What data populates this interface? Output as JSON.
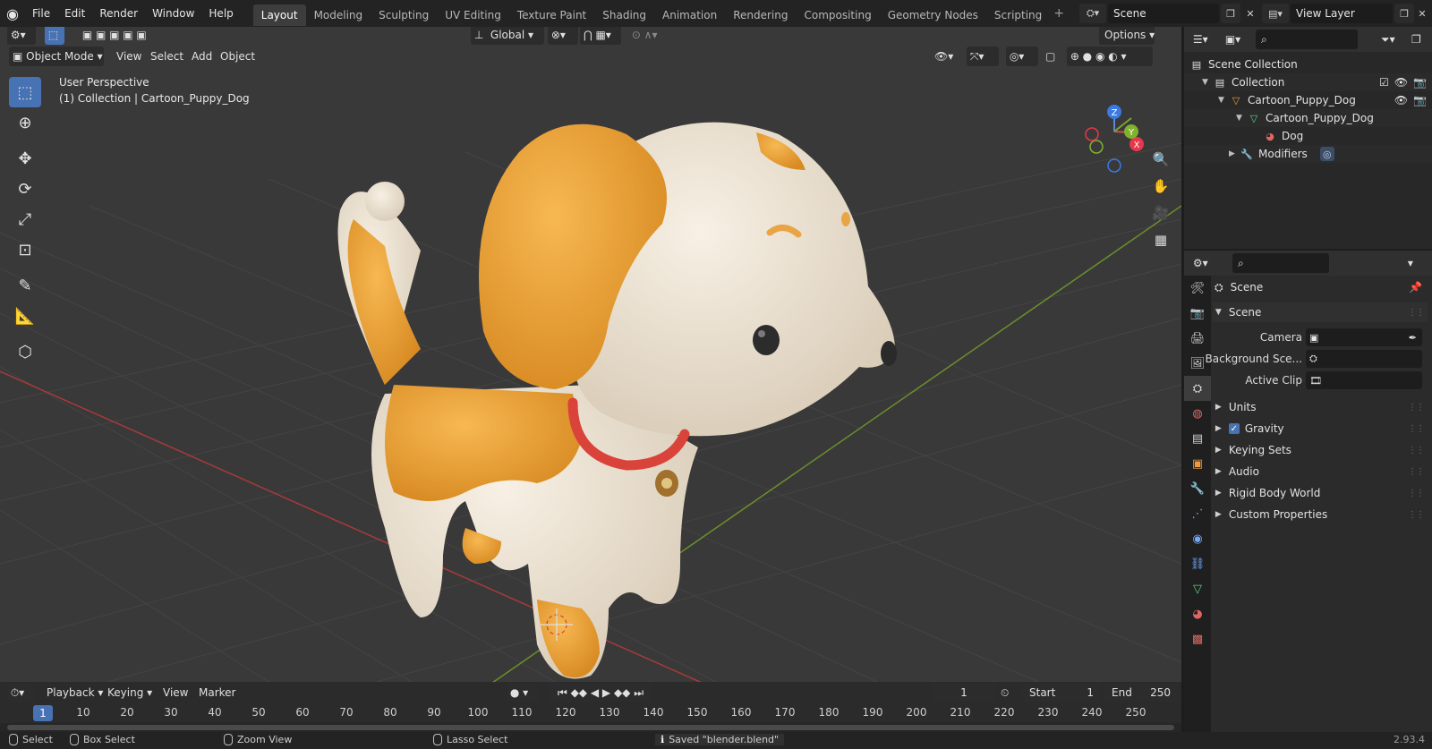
{
  "menubar": {
    "items": [
      "File",
      "Edit",
      "Render",
      "Window",
      "Help"
    ],
    "workspaces": [
      "Layout",
      "Modeling",
      "Sculpting",
      "UV Editing",
      "Texture Paint",
      "Shading",
      "Animation",
      "Rendering",
      "Compositing",
      "Geometry Nodes",
      "Scripting"
    ],
    "active_workspace": "Layout",
    "scene_name": "Scene",
    "view_layer": "View Layer"
  },
  "viewport": {
    "mode": "Object Mode",
    "menu": [
      "View",
      "Select",
      "Add",
      "Object"
    ],
    "transform_orientation": "Global",
    "options_label": "Options",
    "perspective_label": "User Perspective",
    "collection_label": "(1) Collection | Cartoon_Puppy_Dog",
    "gizmo_axes": {
      "x": "X",
      "y": "Y",
      "z": "Z"
    }
  },
  "tools": [
    "select-box-tool",
    "cursor-tool",
    "move-tool",
    "rotate-tool",
    "scale-tool",
    "transform-tool",
    "annotate-tool",
    "measure-tool",
    "add-cube-tool"
  ],
  "timeline": {
    "menu": [
      "Playback",
      "Keying",
      "View",
      "Marker"
    ],
    "current_frame": "1",
    "start_label": "Start",
    "start": "1",
    "end_label": "End",
    "end": "250",
    "ruler": [
      "1",
      "10",
      "20",
      "30",
      "40",
      "50",
      "60",
      "70",
      "80",
      "90",
      "100",
      "110",
      "120",
      "130",
      "140",
      "150",
      "160",
      "170",
      "180",
      "190",
      "200",
      "210",
      "220",
      "230",
      "240",
      "250"
    ]
  },
  "statusbar": {
    "select": "Select",
    "box_select": "Box Select",
    "zoom_view": "Zoom View",
    "lasso_select": "Lasso Select",
    "message": "Saved \"blender.blend\"",
    "version": "2.93.4"
  },
  "outliner": {
    "rows": [
      {
        "label": "Scene Collection"
      },
      {
        "label": "Collection"
      },
      {
        "label": "Cartoon_Puppy_Dog"
      },
      {
        "label": "Cartoon_Puppy_Dog"
      },
      {
        "label": "Dog"
      },
      {
        "label": "Modifiers"
      }
    ]
  },
  "properties": {
    "context": "Scene",
    "panel_title": "Scene",
    "camera_label": "Camera",
    "background_label": "Background Sce...",
    "active_clip_label": "Active Clip",
    "panels": [
      "Units",
      "Gravity",
      "Keying Sets",
      "Audio",
      "Rigid Body World",
      "Custom Properties"
    ]
  },
  "colors": {
    "accent": "#4772b3",
    "viewport_bg": "#393939",
    "x_axis": "#a83a3a",
    "y_axis": "#6b8f2a",
    "dog_orange": "#f2a63c",
    "dog_cream": "#efe6d8",
    "collar": "#d9433a"
  }
}
